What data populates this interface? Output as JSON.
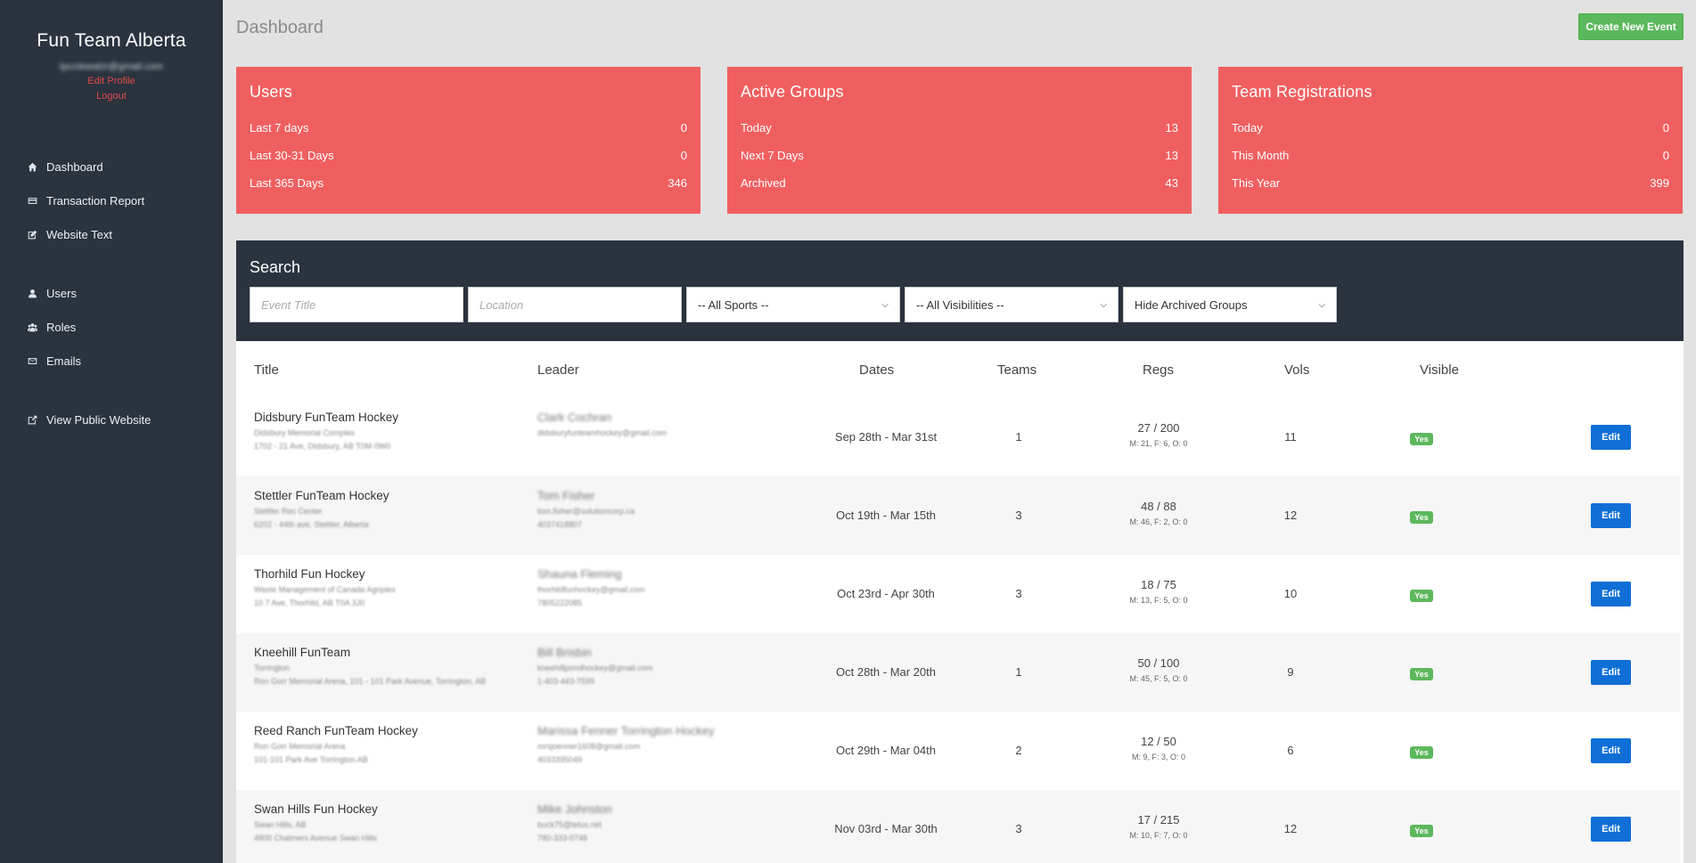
{
  "sidebar": {
    "brand": "Fun Team Alberta",
    "email": "tpcclewalzr@gmail.com",
    "edit_profile": "Edit Profile",
    "logout": "Logout",
    "nav_primary": [
      {
        "label": "Dashboard",
        "icon": "home-icon"
      },
      {
        "label": "Transaction Report",
        "icon": "credit-card-icon"
      },
      {
        "label": "Website Text",
        "icon": "edit-icon"
      }
    ],
    "nav_secondary": [
      {
        "label": "Users",
        "icon": "user-icon"
      },
      {
        "label": "Roles",
        "icon": "users-icon"
      },
      {
        "label": "Emails",
        "icon": "envelope-icon"
      }
    ],
    "nav_tertiary": [
      {
        "label": "View Public Website",
        "icon": "external-link-icon"
      }
    ]
  },
  "header": {
    "title": "Dashboard",
    "create_button": "Create New Event"
  },
  "cards": [
    {
      "title": "Users",
      "rows": [
        {
          "label": "Last 7 days",
          "value": "0"
        },
        {
          "label": "Last 30-31 Days",
          "value": "0"
        },
        {
          "label": "Last 365 Days",
          "value": "346"
        }
      ]
    },
    {
      "title": "Active Groups",
      "rows": [
        {
          "label": "Today",
          "value": "13"
        },
        {
          "label": "Next 7 Days",
          "value": "13"
        },
        {
          "label": "Archived",
          "value": "43"
        }
      ]
    },
    {
      "title": "Team Registrations",
      "rows": [
        {
          "label": "Today",
          "value": "0"
        },
        {
          "label": "This Month",
          "value": "0"
        },
        {
          "label": "This Year",
          "value": "399"
        }
      ]
    }
  ],
  "search": {
    "title": "Search",
    "event_title_placeholder": "Event Title",
    "location_placeholder": "Location",
    "sports_selected": "-- All Sports --",
    "visibility_selected": "-- All Visibilities --",
    "archive_selected": "Hide Archived Groups"
  },
  "table": {
    "headers": {
      "title": "Title",
      "leader": "Leader",
      "dates": "Dates",
      "teams": "Teams",
      "regs": "Regs",
      "vols": "Vols",
      "visible": "Visible"
    },
    "edit_label": "Edit",
    "rows": [
      {
        "title": "Didsbury FunTeam Hockey",
        "venue": "Didsbury Memorial Complex",
        "address": "1702 - 21 Ave, Didsbury, AB T0M 0W0",
        "leader_name": "Clark Cochran",
        "leader_email": "didsburyfunteamhockey@gmail.com",
        "leader_phone": "",
        "dates": "Sep 28th - Mar 31st",
        "teams": "1",
        "regs": "27 / 200",
        "regs_detail": "M: 21, F: 6, O: 0",
        "vols": "11",
        "visible": "Yes"
      },
      {
        "title": "Stettler FunTeam Hockey",
        "venue": "Stettler Rec Center",
        "address": "6202 - 44th ave. Stettler, Alberta",
        "leader_name": "Tom Fisher",
        "leader_email": "tom.fisher@solutioncorp.ca",
        "leader_phone": "4037418807",
        "dates": "Oct 19th - Mar 15th",
        "teams": "3",
        "regs": "48 / 88",
        "regs_detail": "M: 46, F: 2, O: 0",
        "vols": "12",
        "visible": "Yes"
      },
      {
        "title": "Thorhild Fun Hockey",
        "venue": "Waste Management of Canada Agriplex",
        "address": "10 7 Ave, Thorhild, AB T0A 3J0",
        "leader_name": "Shauna Fleming",
        "leader_email": "thorhildfunhockey@gmail.com",
        "leader_phone": "7805222085",
        "dates": "Oct 23rd - Apr 30th",
        "teams": "3",
        "regs": "18 / 75",
        "regs_detail": "M: 13, F: 5, O: 0",
        "vols": "10",
        "visible": "Yes"
      },
      {
        "title": "Kneehill FunTeam",
        "venue": "Torrington",
        "address": "Ron Gorr Memorial Arena, 101 - 101 Park Avenue, Torrington, AB",
        "leader_name": "Bill Brisbin",
        "leader_email": "kneehillpondhockey@gmail.com",
        "leader_phone": "1-403-443-7599",
        "dates": "Oct 28th - Mar 20th",
        "teams": "1",
        "regs": "50 / 100",
        "regs_detail": "M: 45, F: 5, O: 0",
        "vols": "9",
        "visible": "Yes"
      },
      {
        "title": "Reed Ranch FunTeam Hockey",
        "venue": "Ron Gorr Memorial Arena",
        "address": "101-101 Park Ave Torrington AB",
        "leader_name": "Marissa Fenner Torrington Hockey",
        "leader_email": "mrsjoenner1608@gmail.com",
        "leader_phone": "4033395049",
        "dates": "Oct 29th - Mar 04th",
        "teams": "2",
        "regs": "12 / 50",
        "regs_detail": "M: 9, F: 3, O: 0",
        "vols": "6",
        "visible": "Yes"
      },
      {
        "title": "Swan Hills Fun Hockey",
        "venue": "Swan Hills, AB",
        "address": "4800 Chalmers Avenue Swan Hills",
        "leader_name": "Mike Johnston",
        "leader_email": "buck75@telus.net",
        "leader_phone": "780-333-0748",
        "dates": "Nov 03rd - Mar 30th",
        "teams": "3",
        "regs": "17 / 215",
        "regs_detail": "M: 10, F: 7, O: 0",
        "vols": "12",
        "visible": "Yes"
      }
    ]
  },
  "colors": {
    "sidebar_bg": "#2a333e",
    "card_red": "#f05f60",
    "success_green": "#5cb85c",
    "primary_blue": "#0f6fd6",
    "link_red": "#e34a4a"
  }
}
